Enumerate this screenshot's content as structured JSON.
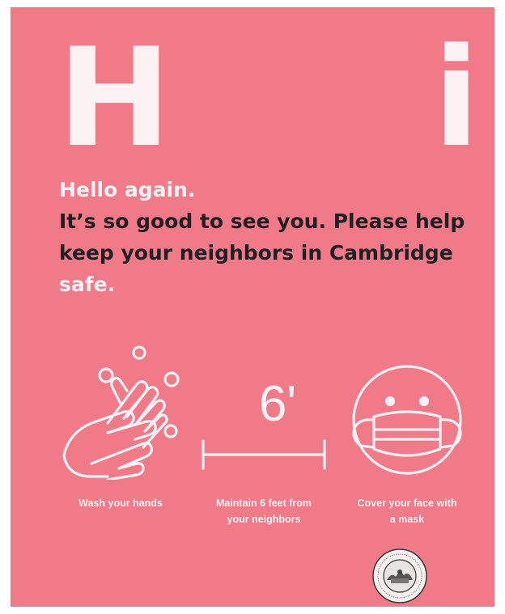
{
  "poster": {
    "big_letters": {
      "left": "H",
      "right": "i"
    },
    "headline": {
      "line1": "Hello again.",
      "line2_dark": "It’s so good to see you. Please help keep your neighbors in Cambridge",
      "line2_light": " safe."
    },
    "icons": [
      {
        "name": "wash-hands-icon",
        "caption": "Wash your hands"
      },
      {
        "name": "distance-icon",
        "label": "6'",
        "caption_line1": "Maintain 6 feet from",
        "caption_line2": "your neighbors"
      },
      {
        "name": "face-mask-icon",
        "caption_line1": "Cover your face with",
        "caption_line2": "a mask"
      }
    ],
    "seal_icon": "city-seal-icon",
    "colors": {
      "background": "#f07a88",
      "light_text": "#fdf2f3",
      "dark_text": "#1f1f24"
    }
  }
}
